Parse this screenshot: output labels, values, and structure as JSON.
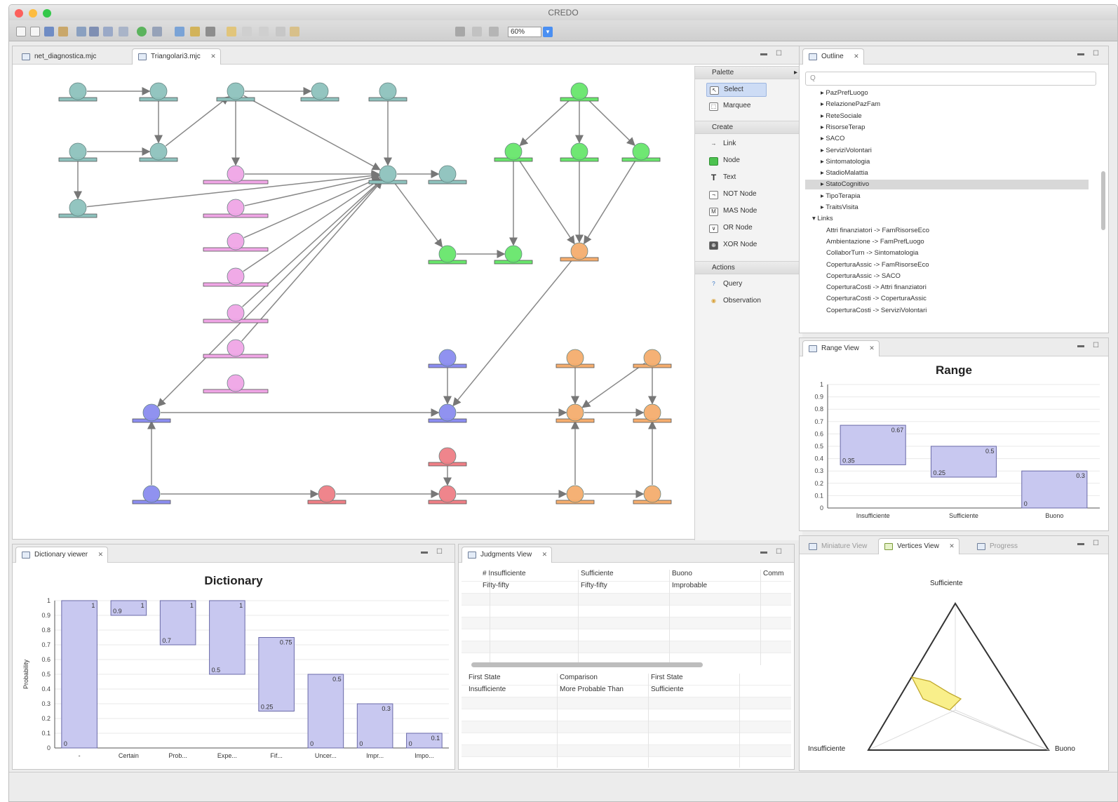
{
  "window": {
    "title": "CREDO"
  },
  "toolbar": {
    "zoom": "60%",
    "zoom_btn": "▾"
  },
  "editor": {
    "tabs": [
      {
        "label": "net_diagnostica.mjc"
      },
      {
        "label": "Triangolari3.mjc"
      }
    ],
    "colors": {
      "teal": "#8ec2bd",
      "pink": "#f0a6e6",
      "green": "#68e66c",
      "blue": "#8b8df0",
      "orange": "#f5ad6e",
      "red": "#ef7f86"
    }
  },
  "palette": {
    "header": "Palette",
    "items_top": [
      "Select",
      "Marquee"
    ],
    "create_header": "Create",
    "create_items": [
      "Link",
      "Node",
      "Text",
      "NOT Node",
      "MAS Node",
      "OR Node",
      "XOR Node"
    ],
    "actions_header": "Actions",
    "action_items": [
      "Query",
      "Observation"
    ]
  },
  "outline": {
    "tab": "Outline",
    "search_placeholder": "Q",
    "items": [
      "▸ PazPrefLuogo",
      "▸ RelazionePazFam",
      "▸ ReteSociale",
      "▸ RisorseTerap",
      "▸ SACO",
      "▸ ServiziVolontari",
      "▸ Sintomatologia",
      "▸ StadioMalattia",
      "▸ StatoCognitivo",
      "▸ TipoTerapia",
      "▸ TraitsVisita",
      "▾ Links",
      "Attri finanziatori -> FamRisorseEco",
      "Ambientazione -> FamPrefLuogo",
      "CollaborTurn -> Sintomatologia",
      "CoperturaAssic -> FamRisorseEco",
      "CoperturaAssic -> SACO",
      "CoperturaCosti -> Attri finanziatori",
      "CoperturaCosti -> CoperturaAssic",
      "CoperturaCosti -> ServiziVolontari"
    ],
    "selected_index": 8
  },
  "range_view": {
    "tab": "Range View",
    "chart_data": {
      "type": "bar",
      "title": "Range",
      "categories": [
        "Insufficiente",
        "Sufficiente",
        "Buono"
      ],
      "ranges": [
        {
          "low": 0.35,
          "high": 0.67
        },
        {
          "low": 0.25,
          "high": 0.5
        },
        {
          "low": 0,
          "high": 0.3
        }
      ],
      "low_labels": [
        "0.35",
        "0.25",
        "0"
      ],
      "high_labels": [
        "0.67",
        "0.5",
        "0.3"
      ],
      "ylim": [
        0,
        1
      ],
      "yticks": [
        "0",
        "0.1",
        "0.2",
        "0.3",
        "0.4",
        "0.5",
        "0.6",
        "0.7",
        "0.8",
        "0.9",
        "1"
      ]
    }
  },
  "dictionary": {
    "tab": "Dictionary viewer",
    "chart_data": {
      "type": "bar",
      "title": "Dictionary",
      "ylabel": "Probability",
      "categories": [
        "-",
        "Certain",
        "Prob...",
        "Expe...",
        "Fif...",
        "Uncer...",
        "Impr...",
        "Impo..."
      ],
      "ranges": [
        {
          "low": 0,
          "high": 1
        },
        {
          "low": 0.9,
          "high": 1
        },
        {
          "low": 0.7,
          "high": 1
        },
        {
          "low": 0.5,
          "high": 1
        },
        {
          "low": 0.25,
          "high": 0.75
        },
        {
          "low": 0,
          "high": 0.5
        },
        {
          "low": 0,
          "high": 0.3
        },
        {
          "low": 0,
          "high": 0.1
        }
      ],
      "low_labels": [
        "0",
        "0.9",
        "0.7",
        "0.5",
        "0.25",
        "0",
        "0",
        "0"
      ],
      "high_labels": [
        "1",
        "1",
        "1",
        "1",
        "0.75",
        "0.5",
        "0.3",
        "0.1"
      ],
      "ylim": [
        0,
        1
      ],
      "yticks": [
        "0",
        "0.1",
        "0.2",
        "0.3",
        "0.4",
        "0.5",
        "0.6",
        "0.7",
        "0.8",
        "0.9",
        "1"
      ]
    }
  },
  "judgments": {
    "tab": "Judgments View",
    "top_headers": [
      "# Insufficiente",
      "Sufficiente",
      "Buono",
      "Comm"
    ],
    "top_row": [
      "Fifty-fifty",
      "Fifty-fifty",
      "Improbable",
      ""
    ],
    "bottom_headers": [
      "First State",
      "Comparison",
      "First State"
    ],
    "bottom_row": [
      "Insufficiente",
      "More Probable Than",
      "Sufficiente"
    ]
  },
  "vertices": {
    "tabs": [
      "Miniature View",
      "Vertices View",
      "Progress"
    ],
    "labels": {
      "top": "Sufficiente",
      "left": "Insufficiente",
      "right": "Buono"
    }
  }
}
